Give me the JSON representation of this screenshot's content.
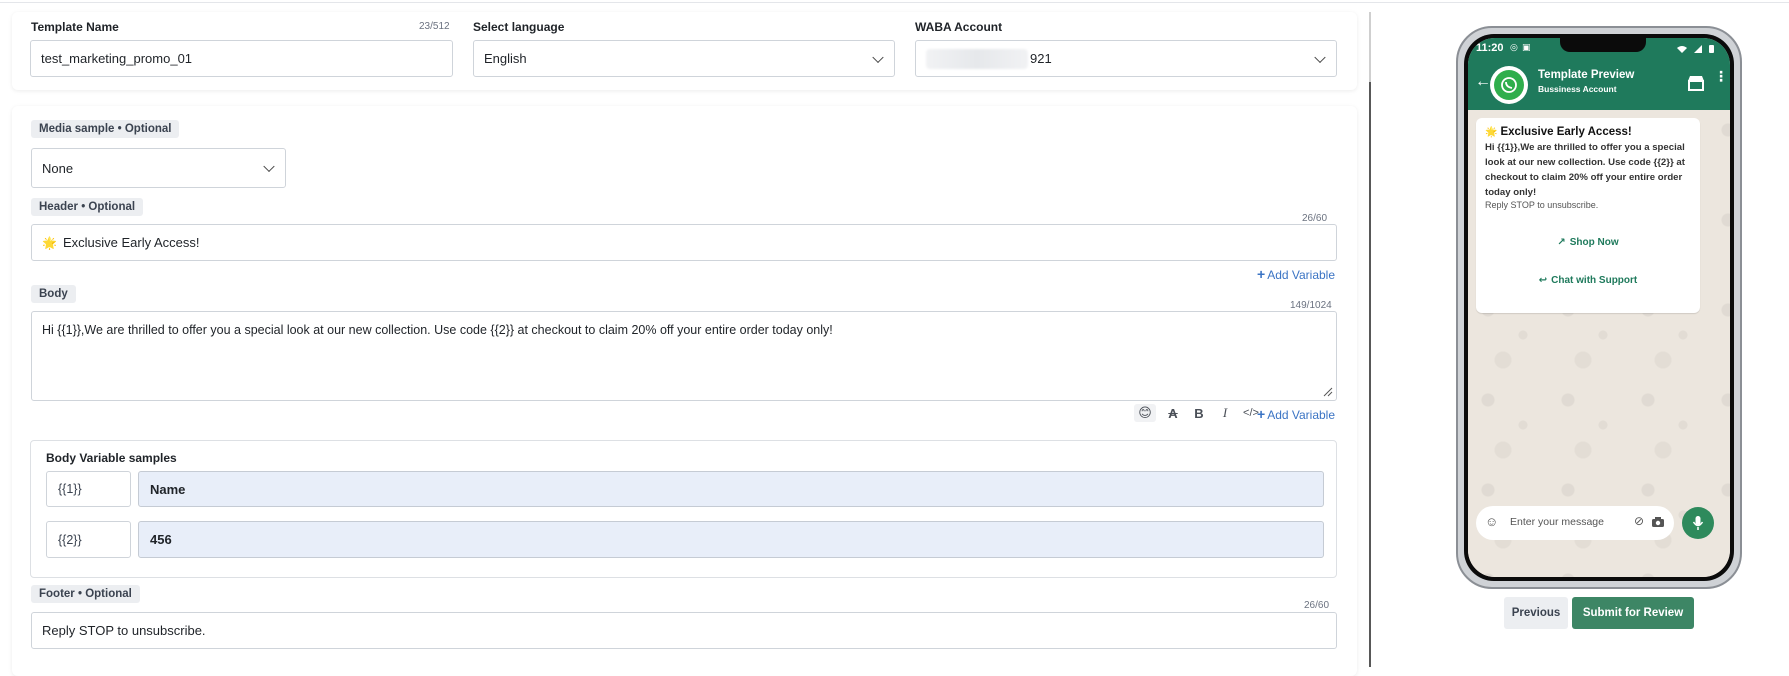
{
  "form": {
    "template_name": {
      "label": "Template Name",
      "counter": "23/512",
      "value": "test_marketing_promo_01"
    },
    "language": {
      "label": "Select language",
      "value": "English"
    },
    "waba": {
      "label": "WABA Account",
      "value_suffix": "921"
    },
    "media": {
      "label": "Media sample",
      "optional": "• Optional",
      "value": "None"
    },
    "header": {
      "label": "Header",
      "optional": "• Optional",
      "counter": "26/60",
      "value": "Exclusive Early Access!",
      "emoji": "🌟",
      "add_variable": "Add Variable"
    },
    "body": {
      "label": "Body",
      "counter": "149/1024",
      "value": "Hi {{1}},We are thrilled to offer you a special look at our new collection. Use code {{2}} at checkout to claim 20% off your entire order today only!",
      "add_variable": "Add Variable",
      "format_tools": [
        "emoji-icon",
        "strikethrough-icon",
        "bold-icon",
        "italic-icon",
        "code-icon"
      ]
    },
    "body_variables": {
      "title": "Body Variable samples",
      "rows": [
        {
          "key": "{{1}}",
          "value": "Name"
        },
        {
          "key": "{{2}}",
          "value": "456"
        }
      ]
    },
    "footer": {
      "label": "Footer",
      "optional": "• Optional",
      "counter": "26/60",
      "value": "Reply STOP to unsubscribe."
    }
  },
  "preview": {
    "status_time": "11:20",
    "title": "Template Preview",
    "subtitle": "Bussiness Account",
    "message": {
      "emoji": "🌟",
      "title": "Exclusive Early Access!",
      "body": "Hi {{1}},We are thrilled to offer you a special look at our new collection. Use code {{2}} at checkout to claim 20% off your entire order today only!",
      "footer": "Reply STOP to unsubscribe.",
      "buttons": [
        "Shop Now",
        "Chat with Support"
      ]
    },
    "input_placeholder": "Enter your message"
  },
  "actions": {
    "previous": "Previous",
    "submit": "Submit for Review"
  },
  "colors": {
    "accent_green": "#1f7a5c",
    "link_blue": "#3b74c4",
    "variable_fill": "#e8eef9"
  }
}
